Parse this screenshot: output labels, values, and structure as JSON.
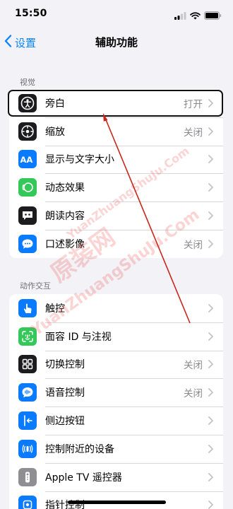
{
  "status_bar": {
    "time": "15:50"
  },
  "nav": {
    "back_label": "设置",
    "title": "辅助功能"
  },
  "sections": [
    {
      "header": "视觉",
      "rows": [
        {
          "label": "旁白",
          "value": "打开",
          "icon": "voiceover-icon",
          "color": "#1c1c1e"
        },
        {
          "label": "缩放",
          "value": "关闭",
          "icon": "zoom-icon",
          "color": "#1c1c1e"
        },
        {
          "label": "显示与文字大小",
          "value": "",
          "icon": "text-size-icon",
          "color": "#0a7aff"
        },
        {
          "label": "动态效果",
          "value": "",
          "icon": "motion-icon",
          "color": "#34c759"
        },
        {
          "label": "朗读内容",
          "value": "",
          "icon": "spoken-content-icon",
          "color": "#1c1c1e"
        },
        {
          "label": "口述影像",
          "value": "关闭",
          "icon": "audio-description-icon",
          "color": "#0a7aff"
        }
      ]
    },
    {
      "header": "动作交互",
      "rows": [
        {
          "label": "触控",
          "value": "",
          "icon": "touch-icon",
          "color": "#0a7aff"
        },
        {
          "label": "面容 ID 与注视",
          "value": "",
          "icon": "face-id-icon",
          "color": "#34c759"
        },
        {
          "label": "切换控制",
          "value": "关闭",
          "icon": "switch-control-icon",
          "color": "#1c1c1e"
        },
        {
          "label": "语音控制",
          "value": "关闭",
          "icon": "voice-control-icon",
          "color": "#0a7aff"
        },
        {
          "label": "侧边按钮",
          "value": "",
          "icon": "side-button-icon",
          "color": "#0a7aff"
        },
        {
          "label": "控制附近的设备",
          "value": "",
          "icon": "nearby-devices-icon",
          "color": "#0a7aff"
        },
        {
          "label": "Apple TV 遥控器",
          "value": "",
          "icon": "apple-tv-remote-icon",
          "color": "#8e8e93"
        },
        {
          "label": "指针控制",
          "value": "",
          "icon": "pointer-control-icon",
          "color": "#0a7aff"
        }
      ]
    }
  ],
  "watermark": {
    "text_cn": "原装网",
    "text_en": "YuanZhuangShuJu.Com"
  }
}
